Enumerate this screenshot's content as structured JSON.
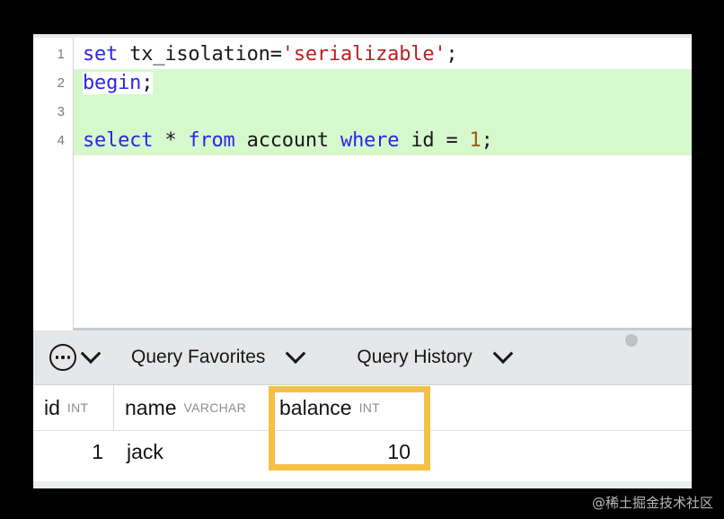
{
  "editor": {
    "lines": [
      {
        "number": "1",
        "highlighted": false,
        "tokens": [
          {
            "text": "set",
            "kind": "kw"
          },
          {
            "text": " ",
            "kind": "plain"
          },
          {
            "text": "tx_isolation=",
            "kind": "plain"
          },
          {
            "text": "'serializable'",
            "kind": "str"
          },
          {
            "text": ";",
            "kind": "punct"
          }
        ],
        "plain": "set tx_isolation='serializable';"
      },
      {
        "number": "2",
        "highlighted": true,
        "tokens": [
          {
            "text": "begin",
            "kind": "kw"
          },
          {
            "text": ";",
            "kind": "punct"
          }
        ],
        "plain": "begin;"
      },
      {
        "number": "3",
        "highlighted": true,
        "tokens": [],
        "plain": ""
      },
      {
        "number": "4",
        "highlighted": true,
        "tokens": [
          {
            "text": "select",
            "kind": "kw"
          },
          {
            "text": " ",
            "kind": "plain"
          },
          {
            "text": "*",
            "kind": "plain"
          },
          {
            "text": " ",
            "kind": "plain"
          },
          {
            "text": "from",
            "kind": "kw"
          },
          {
            "text": " ",
            "kind": "plain"
          },
          {
            "text": "account",
            "kind": "plain"
          },
          {
            "text": " ",
            "kind": "plain"
          },
          {
            "text": "where",
            "kind": "kw"
          },
          {
            "text": " ",
            "kind": "plain"
          },
          {
            "text": "id",
            "kind": "plain"
          },
          {
            "text": " = ",
            "kind": "plain"
          },
          {
            "text": "1",
            "kind": "num"
          },
          {
            "text": ";",
            "kind": "punct"
          }
        ],
        "plain": "select * from account where id = 1;"
      }
    ],
    "selection_color": "#d6f8cd",
    "keyword_color": "#2e25e8",
    "string_color": "#bb1f1f",
    "number_color": "#a05a13"
  },
  "toolbar": {
    "overflow_menu_icon": "ellipsis-circle-icon",
    "overflow_menu_chevron": "chevron-down-icon",
    "favorites_label": "Query Favorites",
    "favorites_chevron": "chevron-down-icon",
    "history_label": "Query History",
    "history_chevron": "chevron-down-icon",
    "grab_handle": "drag-handle-dot"
  },
  "results": {
    "columns": [
      {
        "name": "id",
        "type": "INT"
      },
      {
        "name": "name",
        "type": "VARCHAR"
      },
      {
        "name": "balance",
        "type": "INT"
      }
    ],
    "rows": [
      {
        "id": "1",
        "name": "jack",
        "balance": "10"
      }
    ],
    "highlight_color": "#f5c143",
    "highlighted_column": "balance"
  },
  "watermark": {
    "text": "@稀土掘金技术社区"
  }
}
